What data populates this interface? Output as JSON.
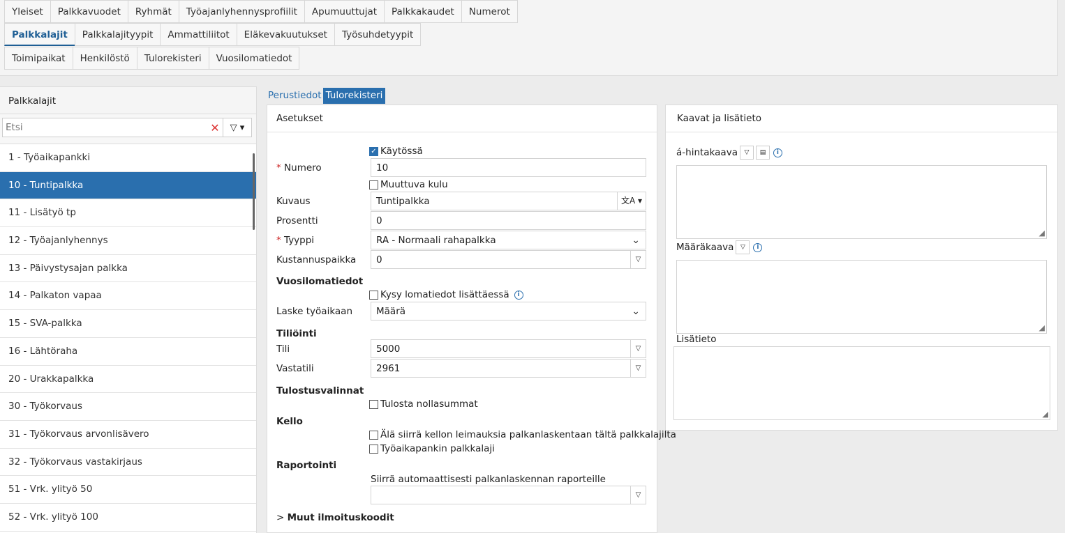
{
  "top_tabs": {
    "row1": [
      "Yleiset",
      "Palkkavuodet",
      "Ryhmät",
      "Työajanlyhennysprofiilit",
      "Apumuuttujat",
      "Palkkakaudet",
      "Numerot"
    ],
    "row2": [
      "Palkkalajit",
      "Palkkalajityypit",
      "Ammattiliitot",
      "Eläkevakuutukset",
      "Työsuhdetyypit"
    ],
    "row3": [
      "Toimipaikat",
      "Henkilöstö",
      "Tulorekisteri",
      "Vuosilomatiedot"
    ],
    "active": "Palkkalajit"
  },
  "left": {
    "title": "Palkkalajit",
    "search_placeholder": "Etsi",
    "items": [
      "1 - Työaikapankki",
      "10 - Tuntipalkka",
      "11 - Lisätyö tp",
      "12 - Työajanlyhennys",
      "13 - Päivystysajan palkka",
      "14 - Palkaton vapaa",
      "15 - SVA-palkka",
      "16 - Lähtöraha",
      "20 - Urakkapalkka",
      "30 - Työkorvaus",
      "31 - Työkorvaus arvonlisävero",
      "32 - Työkorvaus vastakirjaus",
      "51 - Vrk. ylityö 50",
      "52 - Vrk. ylityö 100"
    ],
    "selected_index": 1
  },
  "detail_tabs": {
    "perustiedot": "Perustiedot",
    "tulorekisteri": "Tulorekisteri"
  },
  "settings": {
    "title": "Asetukset",
    "kaytossa": "Käytössä",
    "numero_label": "Numero",
    "numero_value": "10",
    "muuttuva_kulu": "Muuttuva kulu",
    "kuvaus_label": "Kuvaus",
    "kuvaus_value": "Tuntipalkka",
    "prosentti_label": "Prosentti",
    "prosentti_value": "0",
    "tyyppi_label": "Tyyppi",
    "tyyppi_value": "RA - Normaali rahapalkka",
    "kustannuspaikka_label": "Kustannuspaikka",
    "kustannuspaikka_value": "0",
    "vuosilomatiedot": "Vuosilomatiedot",
    "kysy_lomatiedot": "Kysy lomatiedot lisättäessä",
    "laske_label": "Laske työaikaan",
    "laske_value": "Määrä",
    "tiliointi": "Tiliöinti",
    "tili_label": "Tili",
    "tili_value": "5000",
    "vastatili_label": "Vastatili",
    "vastatili_value": "2961",
    "tulostusvalinnat": "Tulostusvalinnat",
    "tulosta_nollasummat": "Tulosta nollasummat",
    "kello": "Kello",
    "ala_siirra": "Älä siirrä kellon leimauksia palkanlaskentaan tältä palkkalajilta",
    "tyoaikapankin": "Työaikapankin palkkalaji",
    "raportointi": "Raportointi",
    "siirra_label": "Siirrä automaattisesti palkanlaskennan raporteille",
    "muut": "Muut ilmoituskoodit"
  },
  "right": {
    "title": "Kaavat ja lisätieto",
    "a_hintakaava": "á-hintakaava",
    "maarakaava": "Määräkaava",
    "lisatieto": "Lisätieto"
  },
  "colors": {
    "accent": "#2a6fae",
    "required": "#cc2222"
  }
}
